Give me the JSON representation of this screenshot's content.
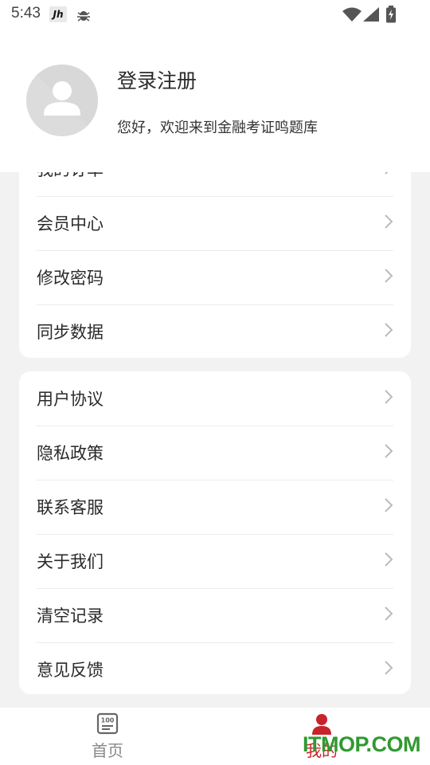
{
  "status_bar": {
    "time": "5:43",
    "app_badge_text": "Jh",
    "icons": [
      "bug-icon",
      "wifi-icon",
      "signal-icon",
      "battery-icon"
    ]
  },
  "profile": {
    "title": "登录注册",
    "subtitle": "您好，欢迎来到金融考证鸣题库",
    "avatar_icon": "user-avatar-icon"
  },
  "menu_group_1": {
    "items": [
      {
        "label": "我的订单"
      },
      {
        "label": "会员中心"
      },
      {
        "label": "修改密码"
      },
      {
        "label": "同步数据"
      }
    ]
  },
  "menu_group_2": {
    "items": [
      {
        "label": "用户协议"
      },
      {
        "label": "隐私政策"
      },
      {
        "label": "联系客服"
      },
      {
        "label": "关于我们"
      },
      {
        "label": "清空记录"
      },
      {
        "label": "意见反馈"
      }
    ]
  },
  "bottom_nav": {
    "items": [
      {
        "label": "首页",
        "icon": "score-100-icon",
        "active": false
      },
      {
        "label": "我的",
        "icon": "person-icon",
        "active": true
      }
    ]
  },
  "watermark": "ITMOP.COM",
  "colors": {
    "accent": "#c8232c",
    "background": "#f2f2f2",
    "card": "#ffffff",
    "watermark": "#2f9a2f"
  }
}
